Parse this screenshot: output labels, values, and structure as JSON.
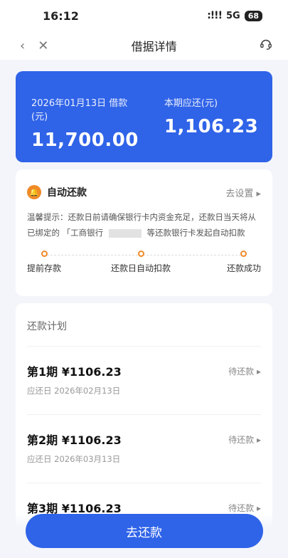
{
  "status": {
    "time": "16:12",
    "signal": ":!!!",
    "network": "5G",
    "battery": "68"
  },
  "nav": {
    "title": "借据详情"
  },
  "summary": {
    "left_label": "2026年01月13日 借款(元)",
    "left_value": "11,700.00",
    "right_label": "本期应还(元)",
    "right_value": "1,106.23"
  },
  "autopay": {
    "title": "自动还款",
    "settings": "去设置 ▸",
    "tip_line1": "温馨提示：还款日前请确保银行卡内资金充足，还款日当天将从",
    "tip_line2": "已绑定的 「工商银行",
    "tip_line2_end": "等还款银行卡发起自动扣款",
    "steps": [
      "提前存款",
      "还款日自动扣款",
      "还款成功"
    ]
  },
  "plan": {
    "title": "还款计划",
    "items": [
      {
        "period": "第1期 ¥1106.23",
        "date": "应还日 2026年02月13日",
        "status": "待还款 ▸"
      },
      {
        "period": "第2期 ¥1106.23",
        "date": "应还日 2026年03月13日",
        "status": "待还款 ▸"
      },
      {
        "period": "第3期 ¥1106.23",
        "date": "",
        "status": "待还款 ▸"
      }
    ]
  },
  "actions": {
    "pay": "去还款"
  },
  "colors": {
    "primary": "#2f63e8",
    "accent": "#f08a28"
  }
}
